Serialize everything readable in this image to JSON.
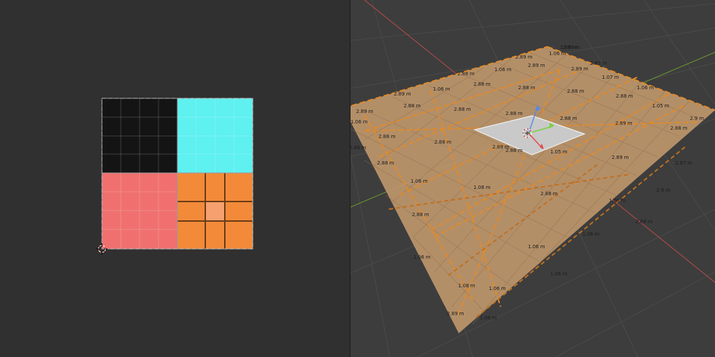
{
  "uv_editor": {
    "islands": [
      {
        "name": "black-island",
        "color": "#141414"
      },
      {
        "name": "cyan-island",
        "color": "#5ff0f0"
      },
      {
        "name": "pink-island",
        "color": "#f07070"
      },
      {
        "name": "orange-island",
        "color": "#f08a3c"
      }
    ],
    "cursor_icon": "uv-2d-cursor-icon"
  },
  "viewport": {
    "plane_color": "#b9936a",
    "axis_x_color": "#c04a4a",
    "axis_y_color": "#6b9a2e",
    "measure_labels": [
      "2.88 m",
      "1.06 m",
      "2.89 m",
      "1.06 m",
      "2.89 m",
      "2.87 m",
      "2.88 m",
      "1.06 m",
      "2.89 m",
      "1.07 m",
      "2.88 m",
      "2.88 m",
      "2.88 m",
      "2.89 m",
      "2.88 m",
      "1.06 m",
      "2.88 m",
      "2.88 m",
      "2.88 m",
      "1.05 m",
      "2.9 m",
      "2.89 m",
      "2.88 m",
      "2.89 m",
      "2.88 m",
      "2.88 m",
      "2.88 m",
      "2.89 m",
      "1.05 m",
      "2.89 m",
      "2.87 m",
      "2.88 m",
      "2.88 m",
      "1.06 m",
      "1.08 m",
      "2.88 m",
      "1.06 m",
      "2.9 m",
      "2.88 m",
      "2.88 m",
      "1.06 m",
      "1.06 m",
      "1.06 m",
      "1.06 m",
      "1.08 m",
      "1.06 m",
      "2.89 m",
      "1.06 m",
      "2.88 m",
      "2.88 m",
      "1.06 m"
    ],
    "gizmo_icon": "transform-gizmo-icon",
    "cursor_icon": "3d-cursor-icon"
  }
}
